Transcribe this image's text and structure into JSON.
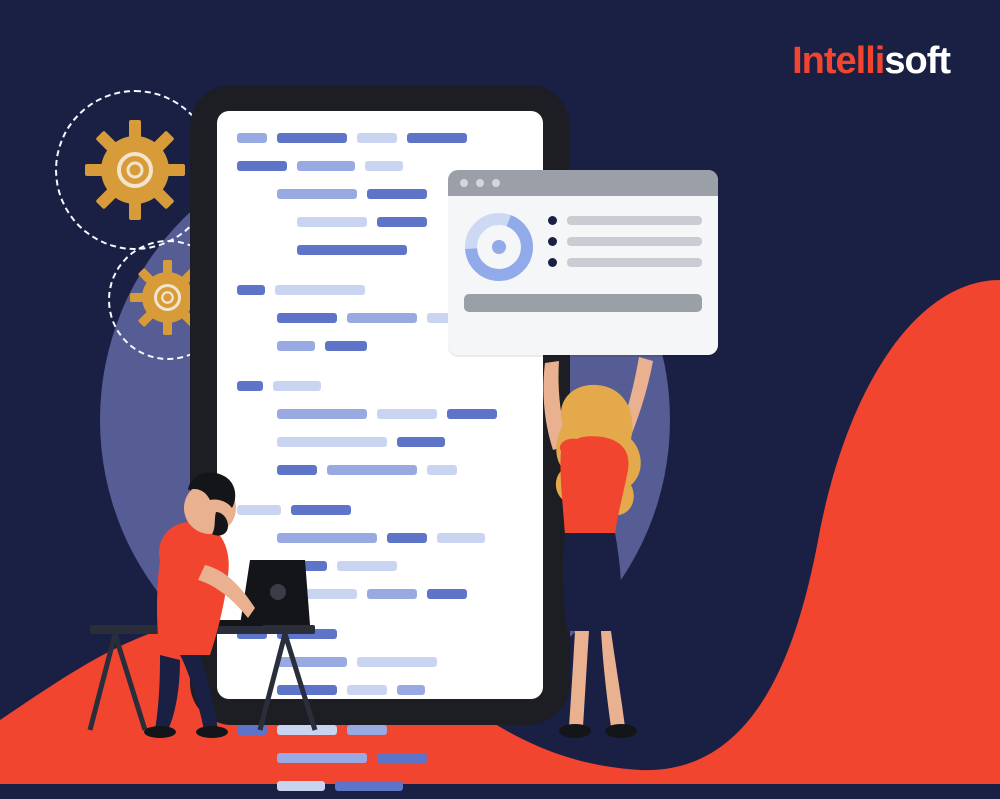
{
  "brand": {
    "first": "Intelli",
    "second": "soft"
  },
  "colors": {
    "backgroundNavy": "#1a1f44",
    "accentRed": "#f24530",
    "circleGrey": "#555d94",
    "gearGold": "#d89b3a",
    "popupGrey": "#f5f6f7",
    "popupHeaderGrey": "#9ba0a8",
    "donutBlue": "#90aaea",
    "codeBlueLight": "#99a9e2",
    "codeBlueDark": "#5e74c9",
    "codeBluePale": "#c9d4f0"
  },
  "icons": {
    "gear": "gear-icon",
    "donutChart": "donut-chart-icon",
    "laptop": "laptop-icon"
  }
}
